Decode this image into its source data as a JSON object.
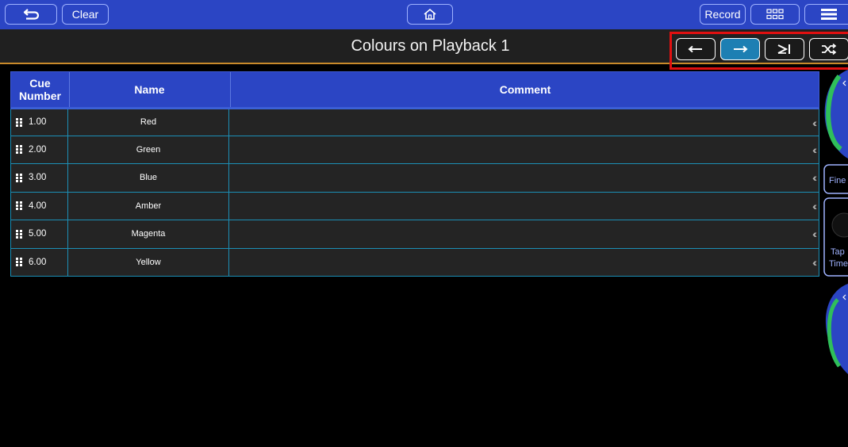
{
  "topbar": {
    "back_icon": "back-arrow-icon",
    "clear_label": "Clear",
    "home_icon": "home-icon",
    "record_label": "Record",
    "grid_icon": "grid-icon",
    "menu_icon": "menu-icon"
  },
  "title": "Colours on Playback 1",
  "nav": {
    "prev_icon": "arrow-left-icon",
    "next_icon": "arrow-right-icon",
    "last_icon": "skip-to-end-icon",
    "random_icon": "shuffle-icon"
  },
  "table": {
    "headers": {
      "cue_number": "Cue Number",
      "name": "Name",
      "comment": "Comment"
    },
    "rows": [
      {
        "cue": "1.00",
        "name": "Red",
        "comment": ""
      },
      {
        "cue": "2.00",
        "name": "Green",
        "comment": ""
      },
      {
        "cue": "3.00",
        "name": "Blue",
        "comment": ""
      },
      {
        "cue": "4.00",
        "name": "Amber",
        "comment": ""
      },
      {
        "cue": "5.00",
        "name": "Magenta",
        "comment": ""
      },
      {
        "cue": "6.00",
        "name": "Yellow",
        "comment": ""
      }
    ]
  },
  "right_panel": {
    "fine_label": "Fine",
    "tap_label": "Tap",
    "time_label": "Time"
  },
  "colors": {
    "accent_blue": "#2b45c4",
    "highlight_red": "#e01010",
    "row_border": "#1c8fb6",
    "active_button": "#1d7fb3",
    "gauge_green": "#2fbf5a",
    "title_underline": "#c98a2a"
  }
}
